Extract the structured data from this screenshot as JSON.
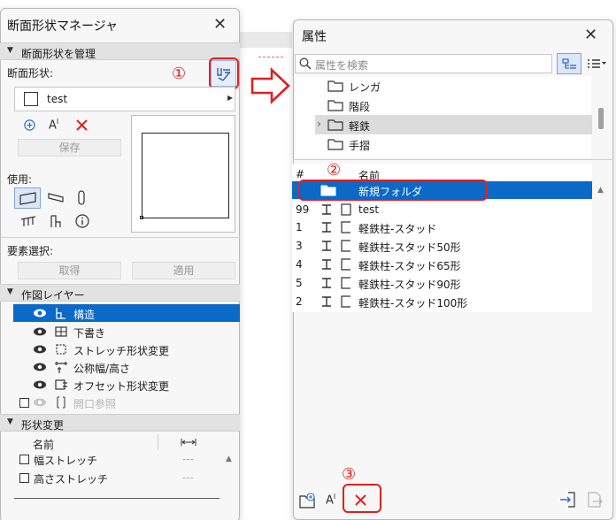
{
  "section_manager": {
    "title": "断面形状マネージャ",
    "manage_header": "断面形状を管理",
    "profile_label": "断面形状:",
    "profile_value": "test",
    "save_label": "保存",
    "use_label": "使用:",
    "element_select_label": "要素選択:",
    "get_label": "取得",
    "apply_label": "適用",
    "layers_header": "作図レイヤー",
    "layers": [
      {
        "label": "構造",
        "selected": true
      },
      {
        "label": "下書き"
      },
      {
        "label": "ストレッチ形状変更"
      },
      {
        "label": "公称幅/高さ"
      },
      {
        "label": "オフセット形状変更"
      },
      {
        "label": "開口参照",
        "disabled": true
      }
    ],
    "modify_header": "形状変更",
    "modify_col_name": "名前",
    "modify_rows": [
      {
        "label": "幅ストレッチ",
        "value": "---"
      },
      {
        "label": "高さストレッチ",
        "value": "---"
      }
    ]
  },
  "attributes": {
    "title": "属性",
    "search_placeholder": "属性を検索",
    "folders": [
      {
        "label": "レンガ"
      },
      {
        "label": "階段"
      },
      {
        "label": "軽鉄",
        "highlighted": true
      },
      {
        "label": "手摺"
      }
    ],
    "col_num": "#",
    "col_name": "名前",
    "rows": [
      {
        "num": "",
        "label": "新規フォルダ",
        "selected": true
      },
      {
        "num": "99",
        "label": "test"
      },
      {
        "num": "1",
        "label": "軽鉄柱-スタッド"
      },
      {
        "num": "3",
        "label": "軽鉄柱-スタッド50形"
      },
      {
        "num": "4",
        "label": "軽鉄柱-スタッド65形"
      },
      {
        "num": "5",
        "label": "軽鉄柱-スタッド90形"
      },
      {
        "num": "2",
        "label": "軽鉄柱-スタッド100形"
      }
    ]
  },
  "annotations": {
    "step1": "①",
    "step2": "②",
    "step3": "③",
    "accent_color": "#e0201f",
    "selection_color": "#0b69c7"
  }
}
